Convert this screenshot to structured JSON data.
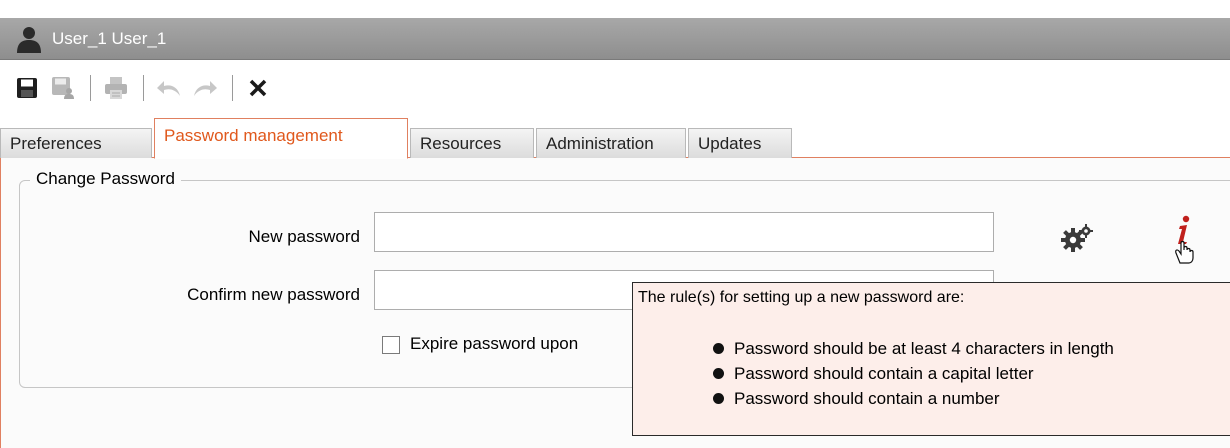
{
  "window": {
    "title": "User_1 User_1",
    "icons": [
      "user-icon"
    ]
  },
  "toolbar": {
    "buttons": [
      {
        "name": "save",
        "icon": "floppy-disk-icon",
        "enabled": true
      },
      {
        "name": "save-and-close",
        "icon": "floppy-disk-person-icon",
        "enabled": false
      },
      {
        "name": "print",
        "icon": "printer-icon",
        "enabled": false
      },
      {
        "name": "undo",
        "icon": "undo-icon",
        "enabled": false
      },
      {
        "name": "redo",
        "icon": "redo-icon",
        "enabled": false
      },
      {
        "name": "close",
        "icon": "close-icon",
        "enabled": true
      }
    ]
  },
  "tabs": [
    {
      "label": "Preferences",
      "active": false
    },
    {
      "label": "Password management",
      "active": true
    },
    {
      "label": "Resources",
      "active": false
    },
    {
      "label": "Administration",
      "active": false
    },
    {
      "label": "Updates",
      "active": false
    }
  ],
  "password_section": {
    "legend": "Change Password",
    "new_password_label": "New password",
    "new_password_value": "",
    "confirm_password_label": "Confirm new password",
    "confirm_password_value": "",
    "expire_checkbox_label": "Expire password upon",
    "expire_checked": false,
    "generate_icon": "gears-icon",
    "info_icon": "info-icon"
  },
  "tooltip": {
    "title": "The rule(s) for setting up a new password are:",
    "rules": [
      "Password should be at least 4 characters in length",
      "Password should contain a capital letter",
      "Password should contain a number"
    ]
  },
  "colors": {
    "accent": "#e0581c",
    "tab_border": "#e08060",
    "titlebar": "#999999",
    "tooltip_bg": "#fdeeea",
    "info_icon": "#c0201c"
  }
}
